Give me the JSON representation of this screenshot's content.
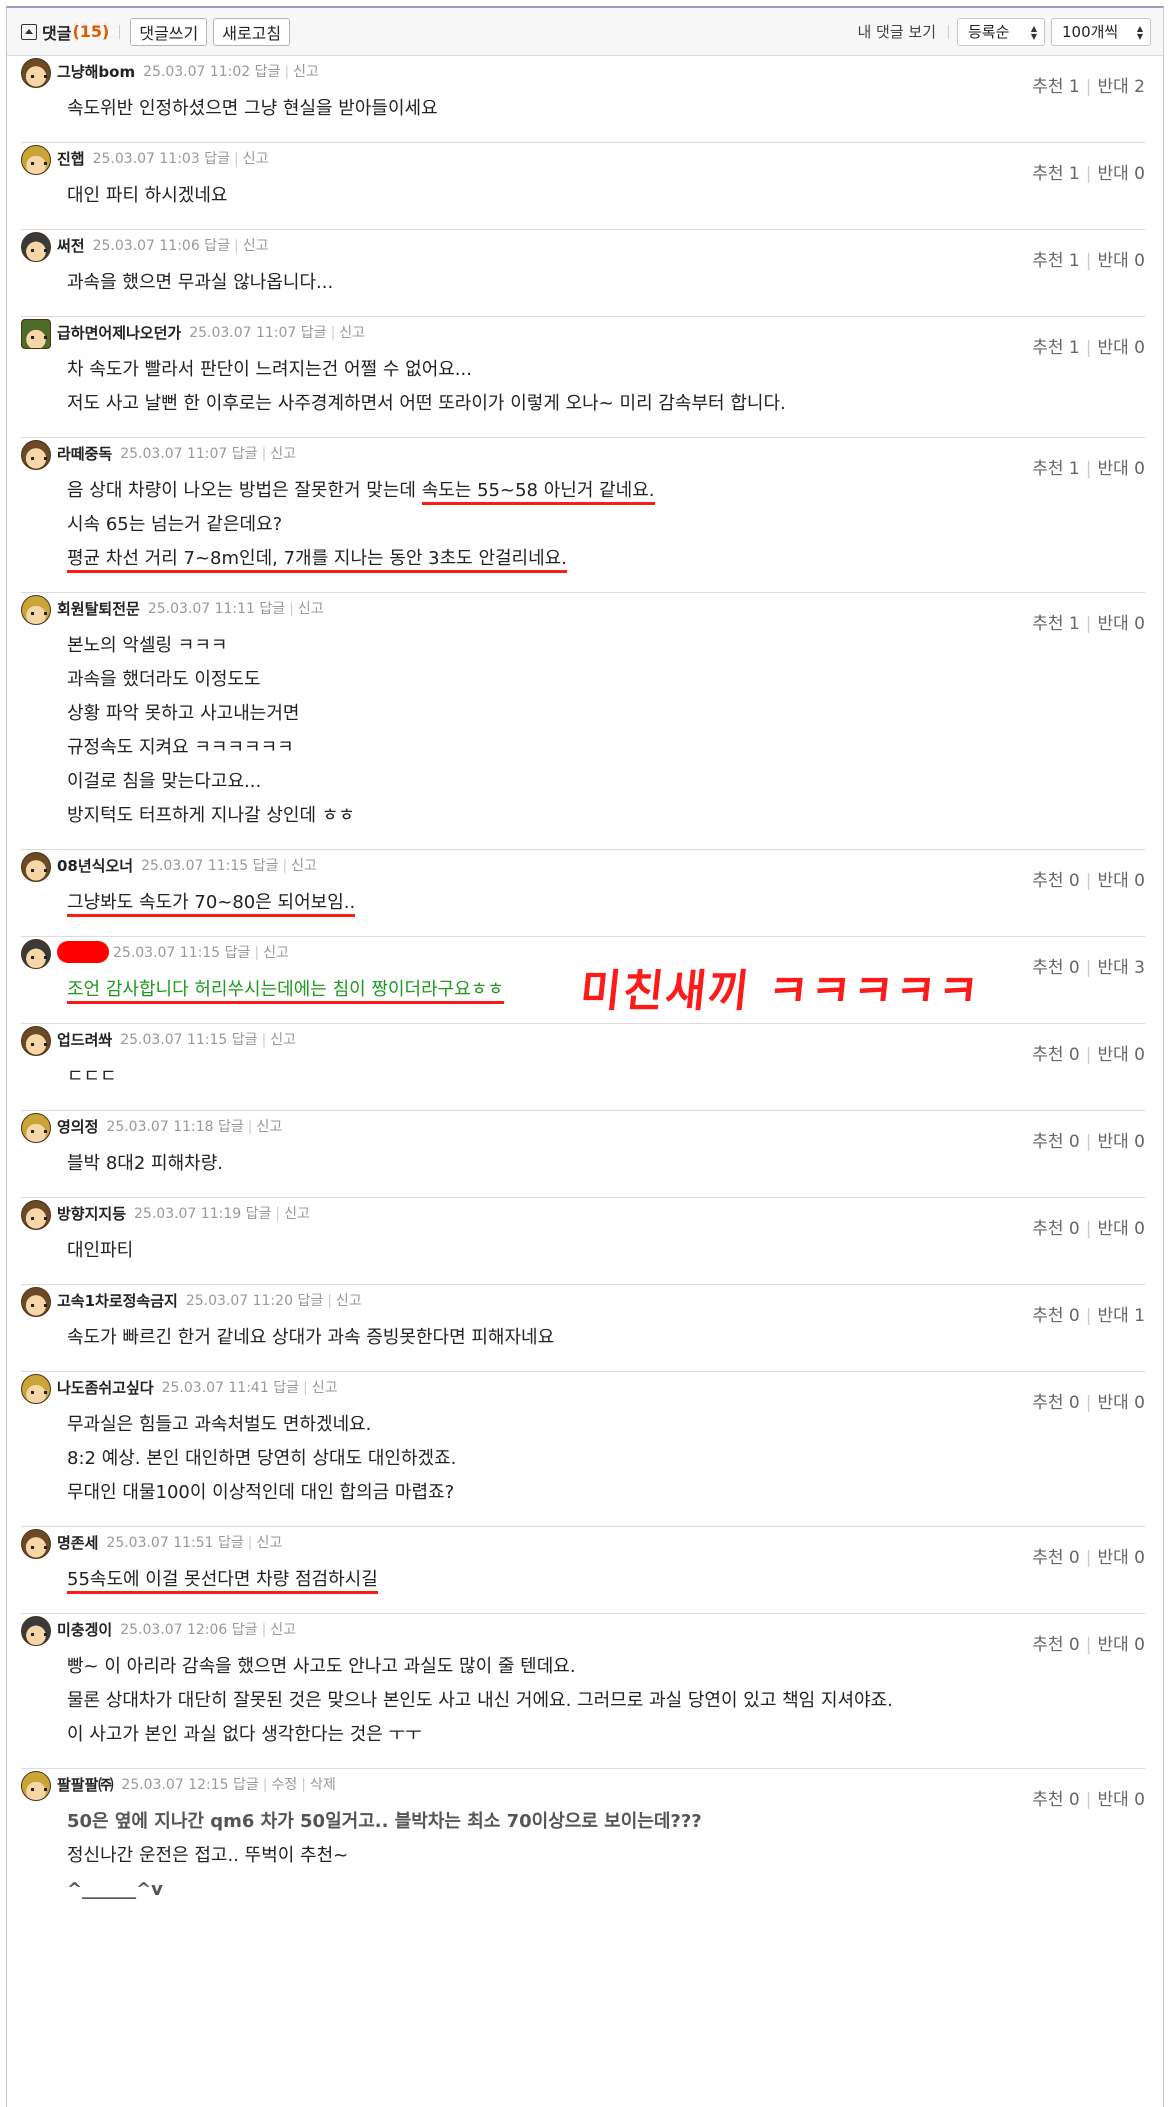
{
  "topbar": {
    "title": "댓글",
    "count": "(15)",
    "write_button": "댓글쓰기",
    "refresh_button": "새로고침",
    "my_comments": "내 댓글 보기",
    "sort_select": "등록순",
    "per_page_select": "100개씩"
  },
  "labels": {
    "reply": "답글",
    "report": "신고",
    "edit": "수정",
    "delete": "삭제",
    "up": "추천",
    "down": "반대"
  },
  "comments": [
    {
      "nick": "그냥해bom",
      "date": "25.03.07 11:02",
      "up": "1",
      "down": "2",
      "lines": [
        "속도위반 인정하셨으면 그냥 현실을 받아들이세요"
      ]
    },
    {
      "nick": "진햅",
      "date": "25.03.07 11:03",
      "up": "1",
      "down": "0",
      "lines": [
        "대인 파티 하시겠네요"
      ]
    },
    {
      "nick": "써전",
      "date": "25.03.07 11:06",
      "up": "1",
      "down": "0",
      "lines": [
        "과속을 했으면 무과실 않나옵니다..."
      ]
    },
    {
      "nick": "급하면어제나오던가",
      "date": "25.03.07 11:07",
      "up": "1",
      "down": "0",
      "lines": [
        "차 속도가 빨라서 판단이 느려지는건 어쩔 수 없어요...",
        "저도 사고 날뻔 한 이후로는 사주경계하면서 어떤 또라이가 이렇게 오나~ 미리 감속부터 합니다."
      ]
    },
    {
      "nick": "라떼중독",
      "date": "25.03.07 11:07",
      "up": "1",
      "down": "0",
      "line1a": "음 상대 차량이 나오는 방법은 잘못한거 맞는데 ",
      "line1b": "속도는 55~58 아닌거 같네요.",
      "line2": "시속 65는 넘는거 같은데요?",
      "line3": "평균 차선 거리 7~8m인데, 7개를 지나는 동안 3초도 안걸리네요."
    },
    {
      "nick": "회원탈퇴전문",
      "date": "25.03.07 11:11",
      "up": "1",
      "down": "0",
      "lines": [
        "본노의 악셀링 ㅋㅋㅋ",
        "과속을 했더라도 이정도도",
        "상황 파악 못하고 사고내는거면",
        "규정속도 지켜요 ㅋㅋㅋㅋㅋㅋ",
        "이걸로 침을 맞는다고요...",
        "방지턱도 터프하게 지나갈 상인데 ㅎㅎ"
      ]
    },
    {
      "nick": "08년식오너",
      "date": "25.03.07 11:15",
      "up": "0",
      "down": "0",
      "line": "그냥봐도 속도가 70~80은 되어보임.."
    },
    {
      "nick": "",
      "date": "25.03.07 11:15",
      "up": "0",
      "down": "3",
      "line": "조언 감사합니다 허리쑤시는데에는 침이 짱이더라구요ㅎㅎ",
      "annotation": "미친새끼 ㅋㅋㅋㅋㅋ"
    },
    {
      "nick": "업드려쏴",
      "date": "25.03.07 11:15",
      "up": "0",
      "down": "0",
      "lines": [
        "ㄷㄷㄷ"
      ]
    },
    {
      "nick": "영의정",
      "date": "25.03.07 11:18",
      "up": "0",
      "down": "0",
      "lines": [
        "블박 8대2 피해차량."
      ]
    },
    {
      "nick": "방향지지등",
      "date": "25.03.07 11:19",
      "up": "0",
      "down": "0",
      "lines": [
        "대인파티"
      ]
    },
    {
      "nick": "고속1차로정속금지",
      "date": "25.03.07 11:20",
      "up": "0",
      "down": "1",
      "lines": [
        "속도가 빠르긴 한거 같네요 상대가 과속 증빙못한다면 피해자네요"
      ]
    },
    {
      "nick": "나도좀쉬고싶다",
      "date": "25.03.07 11:41",
      "up": "0",
      "down": "0",
      "lines": [
        "무과실은 힘들고 과속처벌도 면하겠네요.",
        "8:2 예상. 본인 대인하면 당연히 상대도 대인하겠죠.",
        "무대인 대물100이 이상적인데 대인 합의금 마렵죠?"
      ]
    },
    {
      "nick": "명존세",
      "date": "25.03.07 11:51",
      "up": "0",
      "down": "0",
      "line": "55속도에 이걸 못선다면 차량 점검하시길"
    },
    {
      "nick": "미충겡이",
      "date": "25.03.07 12:06",
      "up": "0",
      "down": "0",
      "lines": [
        "빵~ 이 아리라 감속을 했으면 사고도 안나고 과실도 많이 줄 텐데요.",
        "물론 상대차가 대단히 잘못된 것은 맞으나 본인도 사고 내신 거에요. 그러므로 과실 당연이 있고 책임 지셔야죠.",
        "이 사고가 본인 과실 없다 생각한다는 것은 ㅜㅜ"
      ]
    },
    {
      "nick": "팔팔팔㈜",
      "date": "25.03.07 12:15",
      "up": "0",
      "down": "0",
      "lines": [
        "50은 옆에 지나간 qm6 차가 50일거고.. 블박차는 최소 70이상으로 보이는데???",
        "정신나간 운전은 접고.. 뚜벅이 추천~",
        "^______^v"
      ]
    }
  ]
}
